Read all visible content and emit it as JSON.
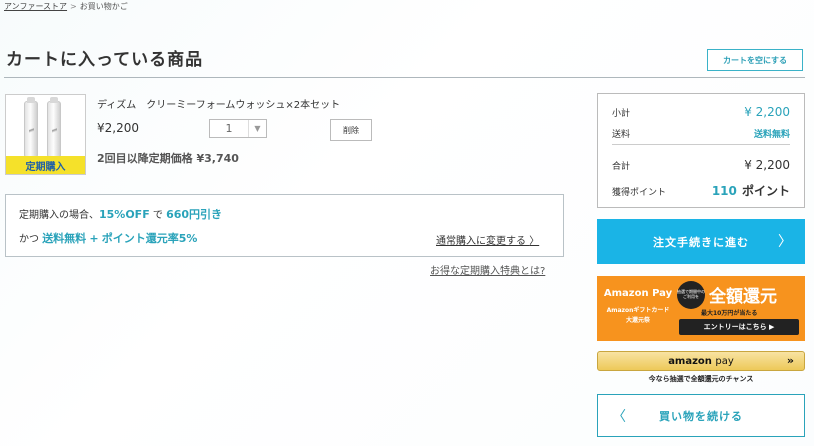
{
  "breadcrumb": {
    "home": "アンファーストア",
    "separator": ">",
    "current": "お買い物かご"
  },
  "page_title": "カートに入っている商品",
  "empty_cart_label": "カートを空にする",
  "item": {
    "badge": "定期購入",
    "name": "ディズム　クリーミーフォームウォッシュ×2本セット",
    "price": "¥2,200",
    "quantity": "1",
    "delete_label": "削除",
    "subsequent_label": "2回目以降定期価格",
    "subsequent_price": "¥3,740"
  },
  "offer": {
    "l1_prefix": "定期購入の場合、",
    "l1_discount": "15%OFF",
    "l1_mid": "で",
    "l1_amount": "660円引き",
    "l2_prefix": "かつ",
    "l2_shipping": "送料無料",
    "l2_plus": "+",
    "l2_points": "ポイント還元率5%",
    "switch_label": "通常購入に変更する",
    "switch_chevron": "〉"
  },
  "benefit_link": "お得な定期購入特典とは?",
  "summary": {
    "subtotal_label": "小計",
    "subtotal_value": "¥ 2,200",
    "shipping_label": "送料",
    "shipping_value": "送料無料",
    "total_label": "合計",
    "total_value": "¥ 2,200",
    "points_label": "獲得ポイント",
    "points_value": "110",
    "points_unit": "ポイント"
  },
  "checkout_label": "注文手続きに進む",
  "checkout_chevron": "〉",
  "amazon_banner": {
    "pay": "Amazon Pay",
    "gift": "Amazonギフトカード",
    "sub": "大還元祭",
    "circle": "抽選で期間中のご利用を",
    "headline": "全額還元",
    "note": "最大10万円が当たる",
    "entry": "エントリーはこちら ▶"
  },
  "amazon_pay": {
    "logo_main": "amazon",
    "logo_sub": "pay",
    "arrows": "»",
    "caption": "今なら抽選で全額還元のチャンス"
  },
  "continue_label": "買い物を続ける",
  "continue_chevron": "〈",
  "colors": {
    "accent": "#2aa3ba",
    "checkout": "#1ab4e6",
    "amazon_orange": "#f7931e",
    "badge_yellow": "#f5e12a"
  }
}
